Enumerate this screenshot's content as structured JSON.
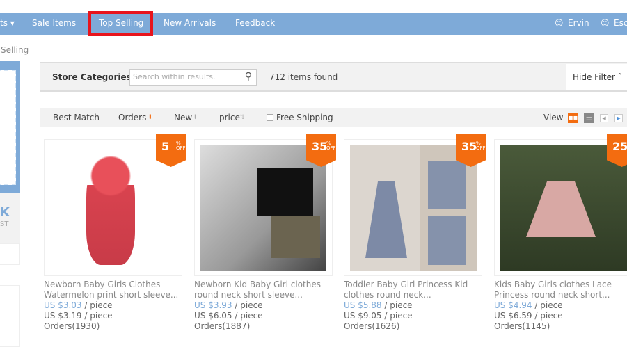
{
  "nav": {
    "items": [
      "ts ▾",
      "Sale Items",
      "Top Selling",
      "New Arrivals",
      "Feedback"
    ],
    "users": [
      "Ervin",
      "Esc"
    ]
  },
  "breadcrumb": "Selling",
  "sidebar": {
    "promo_big": "K",
    "promo_small": "ST"
  },
  "filter": {
    "categories": "Store Categories >",
    "search_placeholder": "Search within results.",
    "count": "712 items found",
    "hide_filter": "Hide Filter ˆ"
  },
  "sort": {
    "best": "Best Match",
    "orders": "Orders",
    "new": "New",
    "price": "price",
    "free_shipping": "Free Shipping",
    "view": "View"
  },
  "products": [
    {
      "discount": "5",
      "title1": "Newborn Baby Girls Clothes",
      "title2": "Watermelon print short sleeve...",
      "price": "US $3.03",
      "unit": " / piece",
      "old": "US $3.19 / piece",
      "orders": "Orders(1930)"
    },
    {
      "discount": "35",
      "title1": "Newborn Kid Baby Girl clothes",
      "title2": "round neck short sleeve...",
      "price": "US $3.93",
      "unit": " / piece",
      "old": "US $6.05 / piece",
      "orders": "Orders(1887)"
    },
    {
      "discount": "35",
      "title1": "Toddler Baby Girl Princess Kid",
      "title2": "clothes round neck...",
      "price": "US $5.88",
      "unit": " / piece",
      "old": "US $9.05 / piece",
      "orders": "Orders(1626)"
    },
    {
      "discount": "25",
      "title1": "Kids Baby Girls clothes Lace",
      "title2": "Princess round neck short...",
      "price": "US $4.94",
      "unit": " / piece",
      "old": "US $6.59 / piece",
      "orders": "Orders(1145)"
    }
  ],
  "badge_suffix": {
    "pct": "%",
    "off": "OFF"
  }
}
